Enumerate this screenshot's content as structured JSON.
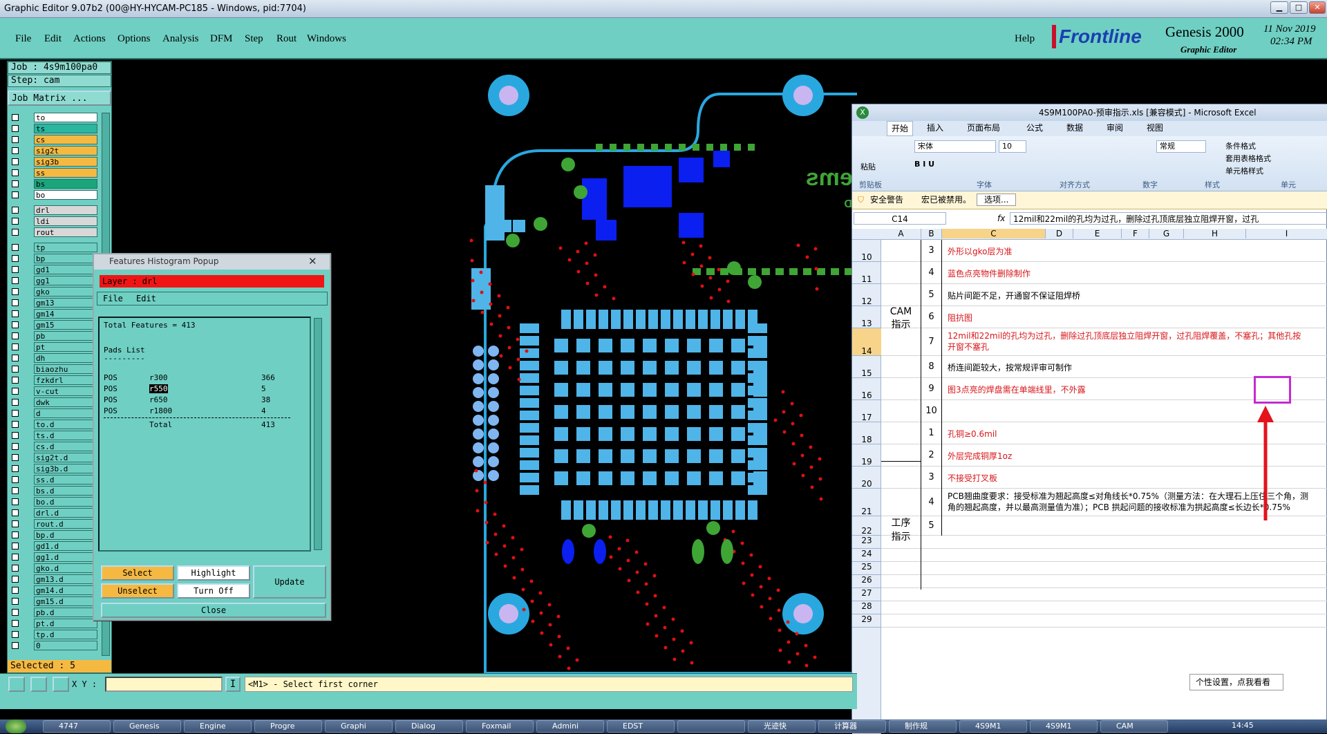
{
  "window": {
    "title": "Graphic Editor 9.07b2 (00@HY-HYCAM-PC185 - Windows, pid:7704)"
  },
  "menu": {
    "items": [
      "File",
      "Edit",
      "Actions",
      "Options",
      "Analysis",
      "DFM",
      "Step",
      "Rout",
      "Windows"
    ],
    "help": "Help"
  },
  "brand": {
    "name": "Frontline",
    "product": "Genesis 2000",
    "module": "Graphic Editor",
    "date": "11 Nov 2019",
    "time": "02:34 PM"
  },
  "job": {
    "job": "Job : 4s9m100pa0",
    "step": "Step: cam",
    "matrix": "Job Matrix ..."
  },
  "layers": [
    {
      "name": "to",
      "color": "#ffffff"
    },
    {
      "name": "ts",
      "color": "#2ab6a0"
    },
    {
      "name": "cs",
      "color": "#f5b942"
    },
    {
      "name": "sig2t",
      "color": "#f5b942"
    },
    {
      "name": "sig3b",
      "color": "#f5b942"
    },
    {
      "name": "ss",
      "color": "#f5b942"
    },
    {
      "name": "bs",
      "color": "#1aa57a"
    },
    {
      "name": "bo",
      "color": "#ffffff"
    },
    {
      "name": "drl",
      "color": "#d8d8d8"
    },
    {
      "name": "ldi",
      "color": "#d8d8d8"
    },
    {
      "name": "rout",
      "color": "#d8d8d8"
    },
    {
      "name": "tp",
      "color": "#6fcfc3"
    },
    {
      "name": "bp",
      "color": "#6fcfc3"
    },
    {
      "name": "gd1",
      "color": "#6fcfc3"
    },
    {
      "name": "gg1",
      "color": "#6fcfc3"
    },
    {
      "name": "gko",
      "color": "#6fcfc3"
    },
    {
      "name": "gm13",
      "color": "#6fcfc3"
    },
    {
      "name": "gm14",
      "color": "#6fcfc3"
    },
    {
      "name": "gm15",
      "color": "#6fcfc3"
    },
    {
      "name": "pb",
      "color": "#6fcfc3"
    },
    {
      "name": "pt",
      "color": "#6fcfc3"
    },
    {
      "name": "dh",
      "color": "#6fcfc3"
    },
    {
      "name": "biaozhu",
      "color": "#6fcfc3"
    },
    {
      "name": "fzkdrl",
      "color": "#6fcfc3"
    },
    {
      "name": "v-cut",
      "color": "#6fcfc3"
    },
    {
      "name": "dwk",
      "color": "#6fcfc3"
    },
    {
      "name": "d",
      "color": "#6fcfc3"
    },
    {
      "name": "to.d",
      "color": "#6fcfc3"
    },
    {
      "name": "ts.d",
      "color": "#6fcfc3"
    },
    {
      "name": "cs.d",
      "color": "#6fcfc3"
    },
    {
      "name": "sig2t.d",
      "color": "#6fcfc3"
    },
    {
      "name": "sig3b.d",
      "color": "#6fcfc3"
    },
    {
      "name": "ss.d",
      "color": "#6fcfc3"
    },
    {
      "name": "bs.d",
      "color": "#6fcfc3"
    },
    {
      "name": "bo.d",
      "color": "#6fcfc3"
    },
    {
      "name": "drl.d",
      "color": "#6fcfc3"
    },
    {
      "name": "rout.d",
      "color": "#6fcfc3"
    },
    {
      "name": "bp.d",
      "color": "#6fcfc3"
    },
    {
      "name": "gd1.d",
      "color": "#6fcfc3"
    },
    {
      "name": "gg1.d",
      "color": "#6fcfc3"
    },
    {
      "name": "gko.d",
      "color": "#6fcfc3"
    },
    {
      "name": "gm13.d",
      "color": "#6fcfc3"
    },
    {
      "name": "gm14.d",
      "color": "#6fcfc3"
    },
    {
      "name": "gm15.d",
      "color": "#6fcfc3"
    },
    {
      "name": "pb.d",
      "color": "#6fcfc3"
    },
    {
      "name": "pt.d",
      "color": "#6fcfc3"
    },
    {
      "name": "tp.d",
      "color": "#6fcfc3"
    },
    {
      "name": "0",
      "color": "#6fcfc3"
    }
  ],
  "selected": "Selected : 5",
  "coords": {
    "label": "X Y :",
    "value": "",
    "prompt": "<M1> - Select first corner"
  },
  "histogram": {
    "title": "Features Histogram Popup",
    "layer": "Layer : drl",
    "menu": [
      "File",
      "Edit"
    ],
    "total_line": "Total Features = 413",
    "pads_header": "Pads List",
    "underline": "---------",
    "rows": [
      {
        "type": "POS",
        "sym": "r300",
        "count": "366"
      },
      {
        "type": "POS",
        "sym": "r550",
        "count": "5"
      },
      {
        "type": "POS",
        "sym": "r650",
        "count": "38"
      },
      {
        "type": "POS",
        "sym": "r1800",
        "count": "4"
      }
    ],
    "total_label": "Total",
    "total_count": "413",
    "buttons": {
      "select": "Select",
      "highlight": "Highlight",
      "unselect": "Unselect",
      "turn_off": "Turn Off",
      "update": "Update",
      "close": "Close"
    }
  },
  "board": {
    "text1": "systems",
    "text2": "LON-D"
  },
  "excel": {
    "title": "4S9M100PA0-预审指示.xls [兼容模式] - Microsoft Excel",
    "tabs": [
      "开始",
      "插入",
      "页面布局",
      "公式",
      "数据",
      "审阅",
      "视图"
    ],
    "font_name": "宋体",
    "font_size": "10",
    "number_format": "常规",
    "ribbon_groups": [
      "剪贴板",
      "字体",
      "对齐方式",
      "数字",
      "样式",
      "单元"
    ],
    "paste": "粘贴",
    "styles": [
      "条件格式",
      "套用表格格式",
      "单元格样式"
    ],
    "security": {
      "label": "安全警告",
      "text": "宏已被禁用。",
      "button": "选项..."
    },
    "name_box": "C14",
    "formula": "12mil和22mil的孔均为过孔，删除过孔顶底层独立阻焊开窗，过孔",
    "columns": [
      "A",
      "B",
      "C",
      "D",
      "E",
      "F",
      "G",
      "H",
      "I"
    ],
    "group1": "CAM\n指示",
    "group2": "工序\n指示",
    "rows": [
      {
        "num": "10",
        "idx": "3",
        "text": "外形以gko层为准",
        "red": true
      },
      {
        "num": "11",
        "idx": "4",
        "text": "蓝色点亮物件删除制作",
        "red": true
      },
      {
        "num": "12",
        "idx": "5",
        "text": "贴片间距不足，开通窗不保证阻焊桥",
        "red": false
      },
      {
        "num": "13",
        "idx": "6",
        "text": "阻抗图",
        "red": true
      },
      {
        "num": "14",
        "idx": "7",
        "text": "12mil和22mil的孔均为过孔，删除过孔顶底层独立阻焊开窗，过孔阻焊覆盖，不塞孔；其他孔按",
        "text2": "开窗不塞孔",
        "red": true
      },
      {
        "num": "15",
        "idx": "8",
        "text": "桥连间距较大，按常规评审可制作",
        "red": false
      },
      {
        "num": "16",
        "idx": "9",
        "text": "图3点亮的焊盘需在单端线里，不外露",
        "red": true
      },
      {
        "num": "17",
        "idx": "10",
        "text": "",
        "red": false
      },
      {
        "num": "18",
        "idx": "1",
        "text": "孔铜≥0.6mil",
        "red": true
      },
      {
        "num": "19",
        "idx": "2",
        "text": "外层完成铜厚1oz",
        "red": true
      },
      {
        "num": "20",
        "idx": "3",
        "text": "不接受打叉板",
        "red": true
      },
      {
        "num": "21",
        "idx": "4",
        "text": "PCB翘曲度要求：接受标准为翘起高度≤对角线长*0.75%（测量方法：在大理石上压住三个角，测",
        "text2": "角的翘起高度，并以最高测量值为准）；PCB 拱起问题的接收标准为拱起高度≤长边长*0.75%",
        "red": false
      },
      {
        "num": "22",
        "idx": "5",
        "text": "",
        "red": false
      }
    ],
    "empty_rows": [
      "23",
      "24",
      "25",
      "26",
      "27",
      "28",
      "29"
    ],
    "tooltip": "个性设置，点我看看"
  },
  "taskbar": {
    "items": [
      "4747",
      "Genesis",
      "Engine",
      "Progre",
      "Graphi",
      "Dialog",
      "Foxmail",
      "Admini",
      "EDST",
      "",
      "光迹快",
      "计算器",
      "制作规",
      "4S9M1",
      "4S9M1",
      "CAM"
    ],
    "clock": "14:45"
  }
}
